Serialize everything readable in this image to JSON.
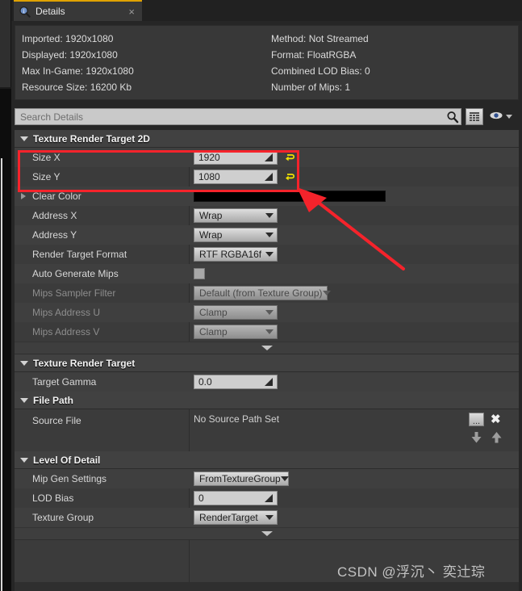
{
  "tab": {
    "label": "Details",
    "icon": "details-magnifier-icon",
    "close": "×",
    "accent_color": "#e0a200"
  },
  "info": {
    "left": [
      "Imported: 1920x1080",
      "Displayed: 1920x1080",
      "Max In-Game: 1920x1080",
      "Resource Size: 16200 Kb"
    ],
    "right": [
      "Method: Not Streamed",
      "Format: FloatRGBA",
      "Combined LOD Bias: 0",
      "Number of Mips: 1"
    ]
  },
  "search": {
    "placeholder": "Search Details",
    "value": "",
    "magnifier_icon": "search-icon",
    "grid_icon": "grid-view-icon",
    "eye_icon": "eye-icon",
    "caret_icon": "chevron-down-icon"
  },
  "sections": [
    {
      "title": "Texture Render Target 2D",
      "rows": [
        {
          "label": "Size X",
          "type": "number",
          "value": "1920",
          "reset": true
        },
        {
          "label": "Size Y",
          "type": "number",
          "value": "1080",
          "reset": true
        },
        {
          "label": "Clear Color",
          "type": "color",
          "value": "#000000",
          "expandable": true
        },
        {
          "label": "Address X",
          "type": "combo",
          "value": "Wrap",
          "width": "w104"
        },
        {
          "label": "Address Y",
          "type": "combo",
          "value": "Wrap",
          "width": "w104"
        },
        {
          "label": "Render Target Format",
          "type": "combo",
          "value": "RTF RGBA16f",
          "width": "w104"
        },
        {
          "label": "Auto Generate Mips",
          "type": "checkbox",
          "value": "unchecked"
        },
        {
          "label": "Mips Sampler Filter",
          "type": "combo",
          "value": "Default (from Texture Group)",
          "width": "w166",
          "disabled": true
        },
        {
          "label": "Mips Address U",
          "type": "combo",
          "value": "Clamp",
          "width": "w104",
          "disabled": true
        },
        {
          "label": "Mips Address V",
          "type": "combo",
          "value": "Clamp",
          "width": "w104",
          "disabled": true
        }
      ]
    },
    {
      "title": "Texture Render Target",
      "rows": [
        {
          "label": "Target Gamma",
          "type": "number",
          "value": "0.0"
        }
      ]
    },
    {
      "title": "File Path",
      "rows": [
        {
          "label": "Source File",
          "type": "filepath",
          "value": "No Source Path Set"
        }
      ]
    },
    {
      "title": "Level Of Detail",
      "rows": [
        {
          "label": "Mip Gen Settings",
          "type": "combo",
          "value": "FromTextureGroup",
          "width": "w118"
        },
        {
          "label": "LOD Bias",
          "type": "number",
          "value": "0"
        },
        {
          "label": "Texture Group",
          "type": "combo",
          "value": "RenderTarget",
          "width": "w104"
        }
      ]
    }
  ],
  "filepath_buttons": {
    "browse": "...",
    "clear": "✖",
    "down_icon": "arrow-down-icon",
    "up_icon": "arrow-up-icon"
  },
  "annotation": {
    "box_color": "#f5232b",
    "arrow_color": "#f5232b"
  },
  "watermark": "CSDN @浮沉丶 奕辻琮"
}
